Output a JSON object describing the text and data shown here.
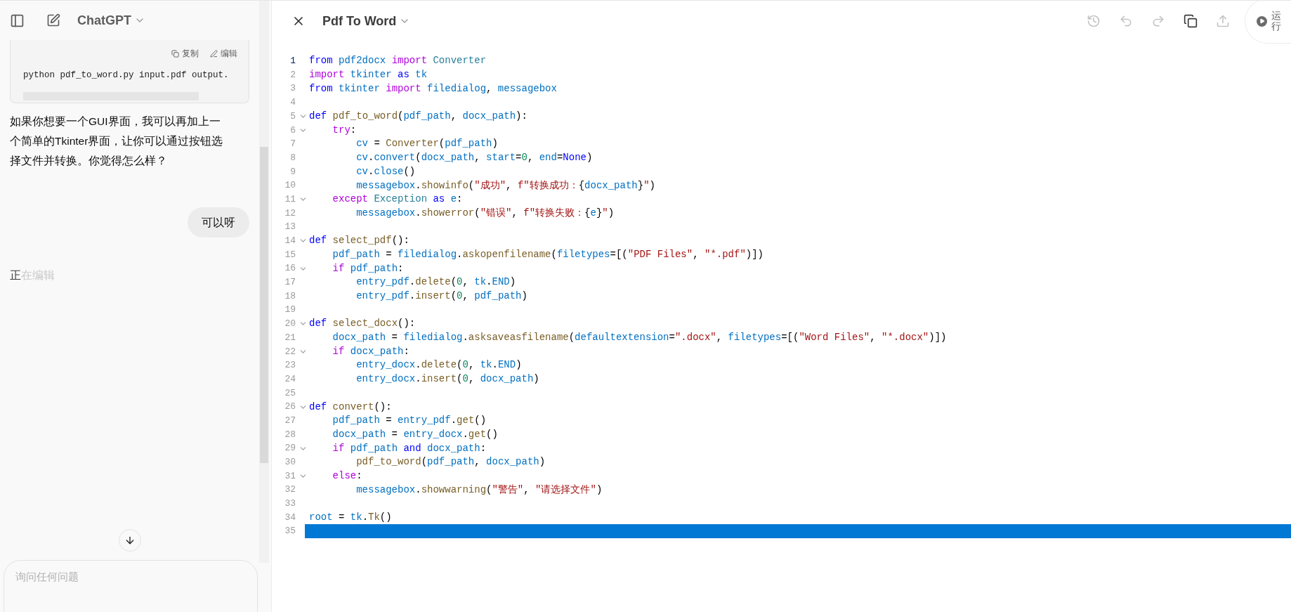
{
  "sidebar": {
    "title": "ChatGPT",
    "code_block": {
      "actions": [
        {
          "kind": "copy",
          "label": "复制"
        },
        {
          "kind": "edit",
          "label": "编辑"
        }
      ],
      "code": "python pdf_to_word.py input.pdf output."
    },
    "assistant_message": "如果你想要一个GUI界面，我可以再加上一个简单的Tkinter界面，让你可以通过按钮选择文件并转换。你觉得怎么样？",
    "user_message": "可以呀",
    "status": {
      "lit": "正",
      "dim": "在编辑"
    },
    "composer": {
      "placeholder": "询问任何问题"
    }
  },
  "editor": {
    "title": "Pdf To Word",
    "toolbar": [
      {
        "kind": "history",
        "disabled": true
      },
      {
        "kind": "undo",
        "disabled": true
      },
      {
        "kind": "redo",
        "disabled": true
      },
      {
        "kind": "copy",
        "disabled": false
      },
      {
        "kind": "share",
        "disabled": true
      }
    ],
    "run_label": "运行",
    "lines": [
      {
        "number": "1",
        "active": true,
        "fold": false,
        "highlighted": false,
        "tokens": [
          {
            "kind": "kw",
            "text": "from"
          },
          {
            "kind": "var",
            "text": " pdf2docx"
          },
          {
            "kind": "ctl",
            "text": " import"
          },
          {
            "kind": "cls",
            "text": " Converter"
          }
        ]
      },
      {
        "number": "2",
        "active": false,
        "fold": false,
        "highlighted": false,
        "tokens": [
          {
            "kind": "ctl",
            "text": "import"
          },
          {
            "kind": "var",
            "text": " tkinter"
          },
          {
            "kind": "kw",
            "text": " as"
          },
          {
            "kind": "var",
            "text": " tk"
          }
        ]
      },
      {
        "number": "3",
        "active": false,
        "fold": false,
        "highlighted": false,
        "tokens": [
          {
            "kind": "kw",
            "text": "from"
          },
          {
            "kind": "var",
            "text": " tkinter"
          },
          {
            "kind": "ctl",
            "text": " import"
          },
          {
            "kind": "var",
            "text": " filedialog"
          },
          {
            "kind": "op",
            "text": ","
          },
          {
            "kind": "var",
            "text": " messagebox"
          }
        ]
      },
      {
        "number": "4",
        "active": false,
        "fold": false,
        "highlighted": false
      },
      {
        "number": "5",
        "active": false,
        "fold": true,
        "highlighted": false,
        "tokens": [
          {
            "kind": "kw",
            "text": "def"
          },
          {
            "kind": "fn",
            "text": " pdf_to_word"
          },
          {
            "kind": "op",
            "text": "("
          },
          {
            "kind": "var",
            "text": "pdf_path"
          },
          {
            "kind": "op",
            "text": ", "
          },
          {
            "kind": "var",
            "text": "docx_path"
          },
          {
            "kind": "op",
            "text": "):"
          }
        ]
      },
      {
        "number": "6",
        "active": false,
        "fold": true,
        "highlighted": false,
        "tokens": [
          {
            "kind": "ctl",
            "text": "    try"
          },
          {
            "kind": "op",
            "text": ":"
          }
        ]
      },
      {
        "number": "7",
        "active": false,
        "fold": false,
        "highlighted": false,
        "tokens": [
          {
            "kind": "var",
            "text": "        cv"
          },
          {
            "kind": "op",
            "text": " = "
          },
          {
            "kind": "fn",
            "text": "Converter"
          },
          {
            "kind": "op",
            "text": "("
          },
          {
            "kind": "var",
            "text": "pdf_path"
          },
          {
            "kind": "op",
            "text": ")"
          }
        ]
      },
      {
        "number": "8",
        "active": false,
        "fold": false,
        "highlighted": false,
        "tokens": [
          {
            "kind": "var",
            "text": "        cv"
          },
          {
            "kind": "op",
            "text": "."
          },
          {
            "kind": "var",
            "text": "convert"
          },
          {
            "kind": "op",
            "text": "("
          },
          {
            "kind": "var",
            "text": "docx_path"
          },
          {
            "kind": "op",
            "text": ", "
          },
          {
            "kind": "var",
            "text": "start"
          },
          {
            "kind": "op",
            "text": "="
          },
          {
            "kind": "num",
            "text": "0"
          },
          {
            "kind": "op",
            "text": ", "
          },
          {
            "kind": "var",
            "text": "end"
          },
          {
            "kind": "op",
            "text": "="
          },
          {
            "kind": "kw",
            "text": "None"
          },
          {
            "kind": "op",
            "text": ")"
          }
        ]
      },
      {
        "number": "9",
        "active": false,
        "fold": false,
        "highlighted": false,
        "tokens": [
          {
            "kind": "var",
            "text": "        cv"
          },
          {
            "kind": "op",
            "text": "."
          },
          {
            "kind": "var",
            "text": "close"
          },
          {
            "kind": "op",
            "text": "()"
          }
        ]
      },
      {
        "number": "10",
        "active": false,
        "fold": false,
        "highlighted": false,
        "tokens": [
          {
            "kind": "var",
            "text": "        messagebox"
          },
          {
            "kind": "op",
            "text": "."
          },
          {
            "kind": "fn",
            "text": "showinfo"
          },
          {
            "kind": "op",
            "text": "("
          },
          {
            "kind": "str",
            "text": "\"成功\""
          },
          {
            "kind": "op",
            "text": ", "
          },
          {
            "kind": "str",
            "text": "f\"转换成功："
          },
          {
            "kind": "op",
            "text": "{"
          },
          {
            "kind": "var",
            "text": "docx_path"
          },
          {
            "kind": "op",
            "text": "}"
          },
          {
            "kind": "str",
            "text": "\""
          },
          {
            "kind": "op",
            "text": ")"
          }
        ]
      },
      {
        "number": "11",
        "active": false,
        "fold": true,
        "highlighted": false,
        "tokens": [
          {
            "kind": "ctl",
            "text": "    except"
          },
          {
            "kind": "cls",
            "text": " Exception"
          },
          {
            "kind": "kw",
            "text": " as"
          },
          {
            "kind": "var",
            "text": " e"
          },
          {
            "kind": "op",
            "text": ":"
          }
        ]
      },
      {
        "number": "12",
        "active": false,
        "fold": false,
        "highlighted": false,
        "tokens": [
          {
            "kind": "var",
            "text": "        messagebox"
          },
          {
            "kind": "op",
            "text": "."
          },
          {
            "kind": "fn",
            "text": "showerror"
          },
          {
            "kind": "op",
            "text": "("
          },
          {
            "kind": "str",
            "text": "\"错误\""
          },
          {
            "kind": "op",
            "text": ", "
          },
          {
            "kind": "str",
            "text": "f\"转换失败："
          },
          {
            "kind": "op",
            "text": "{"
          },
          {
            "kind": "var",
            "text": "e"
          },
          {
            "kind": "op",
            "text": "}"
          },
          {
            "kind": "str",
            "text": "\""
          },
          {
            "kind": "op",
            "text": ")"
          }
        ]
      },
      {
        "number": "13",
        "active": false,
        "fold": false,
        "highlighted": false
      },
      {
        "number": "14",
        "active": false,
        "fold": true,
        "highlighted": false,
        "tokens": [
          {
            "kind": "kw",
            "text": "def"
          },
          {
            "kind": "fn",
            "text": " select_pdf"
          },
          {
            "kind": "op",
            "text": "():"
          }
        ]
      },
      {
        "number": "15",
        "active": false,
        "fold": false,
        "highlighted": false,
        "tokens": [
          {
            "kind": "var",
            "text": "    pdf_path"
          },
          {
            "kind": "op",
            "text": " = "
          },
          {
            "kind": "var",
            "text": "filedialog"
          },
          {
            "kind": "op",
            "text": "."
          },
          {
            "kind": "fn",
            "text": "askopenfilename"
          },
          {
            "kind": "op",
            "text": "("
          },
          {
            "kind": "var",
            "text": "filetypes"
          },
          {
            "kind": "op",
            "text": "=[("
          },
          {
            "kind": "str",
            "text": "\"PDF Files\""
          },
          {
            "kind": "op",
            "text": ", "
          },
          {
            "kind": "str",
            "text": "\"*.pdf\""
          },
          {
            "kind": "op",
            "text": ")])"
          }
        ]
      },
      {
        "number": "16",
        "active": false,
        "fold": true,
        "highlighted": false,
        "tokens": [
          {
            "kind": "ctl",
            "text": "    if"
          },
          {
            "kind": "var",
            "text": " pdf_path"
          },
          {
            "kind": "op",
            "text": ":"
          }
        ]
      },
      {
        "number": "17",
        "active": false,
        "fold": false,
        "highlighted": false,
        "tokens": [
          {
            "kind": "var",
            "text": "        entry_pdf"
          },
          {
            "kind": "op",
            "text": "."
          },
          {
            "kind": "fn",
            "text": "delete"
          },
          {
            "kind": "op",
            "text": "("
          },
          {
            "kind": "num",
            "text": "0"
          },
          {
            "kind": "op",
            "text": ", "
          },
          {
            "kind": "var",
            "text": "tk"
          },
          {
            "kind": "op",
            "text": "."
          },
          {
            "kind": "var",
            "text": "END"
          },
          {
            "kind": "op",
            "text": ")"
          }
        ]
      },
      {
        "number": "18",
        "active": false,
        "fold": false,
        "highlighted": false,
        "tokens": [
          {
            "kind": "var",
            "text": "        entry_pdf"
          },
          {
            "kind": "op",
            "text": "."
          },
          {
            "kind": "fn",
            "text": "insert"
          },
          {
            "kind": "op",
            "text": "("
          },
          {
            "kind": "num",
            "text": "0"
          },
          {
            "kind": "op",
            "text": ", "
          },
          {
            "kind": "var",
            "text": "pdf_path"
          },
          {
            "kind": "op",
            "text": ")"
          }
        ]
      },
      {
        "number": "19",
        "active": false,
        "fold": false,
        "highlighted": false
      },
      {
        "number": "20",
        "active": false,
        "fold": true,
        "highlighted": false,
        "tokens": [
          {
            "kind": "kw",
            "text": "def"
          },
          {
            "kind": "fn",
            "text": " select_docx"
          },
          {
            "kind": "op",
            "text": "():"
          }
        ]
      },
      {
        "number": "21",
        "active": false,
        "fold": false,
        "highlighted": false,
        "tokens": [
          {
            "kind": "var",
            "text": "    docx_path"
          },
          {
            "kind": "op",
            "text": " = "
          },
          {
            "kind": "var",
            "text": "filedialog"
          },
          {
            "kind": "op",
            "text": "."
          },
          {
            "kind": "fn",
            "text": "asksaveasfilename"
          },
          {
            "kind": "op",
            "text": "("
          },
          {
            "kind": "var",
            "text": "defaultextension"
          },
          {
            "kind": "op",
            "text": "="
          },
          {
            "kind": "str",
            "text": "\".docx\""
          },
          {
            "kind": "op",
            "text": ", "
          },
          {
            "kind": "var",
            "text": "filetypes"
          },
          {
            "kind": "op",
            "text": "=[("
          },
          {
            "kind": "str",
            "text": "\"Word Files\""
          },
          {
            "kind": "op",
            "text": ", "
          },
          {
            "kind": "str",
            "text": "\"*.docx\""
          },
          {
            "kind": "op",
            "text": ")])"
          }
        ]
      },
      {
        "number": "22",
        "active": false,
        "fold": true,
        "highlighted": false,
        "tokens": [
          {
            "kind": "ctl",
            "text": "    if"
          },
          {
            "kind": "var",
            "text": " docx_path"
          },
          {
            "kind": "op",
            "text": ":"
          }
        ]
      },
      {
        "number": "23",
        "active": false,
        "fold": false,
        "highlighted": false,
        "tokens": [
          {
            "kind": "var",
            "text": "        entry_docx"
          },
          {
            "kind": "op",
            "text": "."
          },
          {
            "kind": "fn",
            "text": "delete"
          },
          {
            "kind": "op",
            "text": "("
          },
          {
            "kind": "num",
            "text": "0"
          },
          {
            "kind": "op",
            "text": ", "
          },
          {
            "kind": "var",
            "text": "tk"
          },
          {
            "kind": "op",
            "text": "."
          },
          {
            "kind": "var",
            "text": "END"
          },
          {
            "kind": "op",
            "text": ")"
          }
        ]
      },
      {
        "number": "24",
        "active": false,
        "fold": false,
        "highlighted": false,
        "tokens": [
          {
            "kind": "var",
            "text": "        entry_docx"
          },
          {
            "kind": "op",
            "text": "."
          },
          {
            "kind": "fn",
            "text": "insert"
          },
          {
            "kind": "op",
            "text": "("
          },
          {
            "kind": "num",
            "text": "0"
          },
          {
            "kind": "op",
            "text": ", "
          },
          {
            "kind": "var",
            "text": "docx_path"
          },
          {
            "kind": "op",
            "text": ")"
          }
        ]
      },
      {
        "number": "25",
        "active": false,
        "fold": false,
        "highlighted": false
      },
      {
        "number": "26",
        "active": false,
        "fold": true,
        "highlighted": false,
        "tokens": [
          {
            "kind": "kw",
            "text": "def"
          },
          {
            "kind": "fn",
            "text": " convert"
          },
          {
            "kind": "op",
            "text": "():"
          }
        ]
      },
      {
        "number": "27",
        "active": false,
        "fold": false,
        "highlighted": false,
        "tokens": [
          {
            "kind": "var",
            "text": "    pdf_path"
          },
          {
            "kind": "op",
            "text": " = "
          },
          {
            "kind": "var",
            "text": "entry_pdf"
          },
          {
            "kind": "op",
            "text": "."
          },
          {
            "kind": "fn",
            "text": "get"
          },
          {
            "kind": "op",
            "text": "()"
          }
        ]
      },
      {
        "number": "28",
        "active": false,
        "fold": false,
        "highlighted": false,
        "tokens": [
          {
            "kind": "var",
            "text": "    docx_path"
          },
          {
            "kind": "op",
            "text": " = "
          },
          {
            "kind": "var",
            "text": "entry_docx"
          },
          {
            "kind": "op",
            "text": "."
          },
          {
            "kind": "fn",
            "text": "get"
          },
          {
            "kind": "op",
            "text": "()"
          }
        ]
      },
      {
        "number": "29",
        "active": false,
        "fold": true,
        "highlighted": false,
        "tokens": [
          {
            "kind": "ctl",
            "text": "    if"
          },
          {
            "kind": "var",
            "text": " pdf_path"
          },
          {
            "kind": "kw",
            "text": " and"
          },
          {
            "kind": "var",
            "text": " docx_path"
          },
          {
            "kind": "op",
            "text": ":"
          }
        ]
      },
      {
        "number": "30",
        "active": false,
        "fold": false,
        "highlighted": false,
        "tokens": [
          {
            "kind": "fn",
            "text": "        pdf_to_word"
          },
          {
            "kind": "op",
            "text": "("
          },
          {
            "kind": "var",
            "text": "pdf_path"
          },
          {
            "kind": "op",
            "text": ", "
          },
          {
            "kind": "var",
            "text": "docx_path"
          },
          {
            "kind": "op",
            "text": ")"
          }
        ]
      },
      {
        "number": "31",
        "active": false,
        "fold": true,
        "highlighted": false,
        "tokens": [
          {
            "kind": "ctl",
            "text": "    else"
          },
          {
            "kind": "op",
            "text": ":"
          }
        ]
      },
      {
        "number": "32",
        "active": false,
        "fold": false,
        "highlighted": false,
        "tokens": [
          {
            "kind": "var",
            "text": "        messagebox"
          },
          {
            "kind": "op",
            "text": "."
          },
          {
            "kind": "fn",
            "text": "showwarning"
          },
          {
            "kind": "op",
            "text": "("
          },
          {
            "kind": "str",
            "text": "\"警告\""
          },
          {
            "kind": "op",
            "text": ", "
          },
          {
            "kind": "str",
            "text": "\"请选择文件\""
          },
          {
            "kind": "op",
            "text": ")"
          }
        ]
      },
      {
        "number": "33",
        "active": false,
        "fold": false,
        "highlighted": false
      },
      {
        "number": "34",
        "active": false,
        "fold": false,
        "highlighted": false,
        "tokens": [
          {
            "kind": "var",
            "text": "root"
          },
          {
            "kind": "op",
            "text": " = "
          },
          {
            "kind": "var",
            "text": "tk"
          },
          {
            "kind": "op",
            "text": "."
          },
          {
            "kind": "fn",
            "text": "Tk"
          },
          {
            "kind": "op",
            "text": "()"
          }
        ]
      },
      {
        "number": "35",
        "active": false,
        "fold": false,
        "highlighted": true
      }
    ]
  }
}
